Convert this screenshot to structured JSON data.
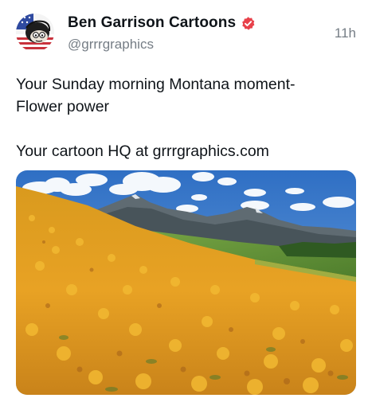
{
  "post": {
    "author": {
      "display_name": "Ben Garrison Cartoons",
      "handle": "@grrrgraphics",
      "verified": true,
      "avatar_icon": "cartoon-avatar"
    },
    "timestamp": "11h",
    "text": {
      "line1": "Your Sunday morning Montana moment-",
      "line2": "Flower power",
      "line3": "Your cartoon HQ at grrrgraphics.com"
    },
    "media": {
      "type": "photo",
      "icon": "photo-montana-flower-field"
    }
  },
  "colors": {
    "verified_badge": "#e8414a",
    "secondary_text": "#757d85",
    "primary_text": "#0f1419"
  }
}
